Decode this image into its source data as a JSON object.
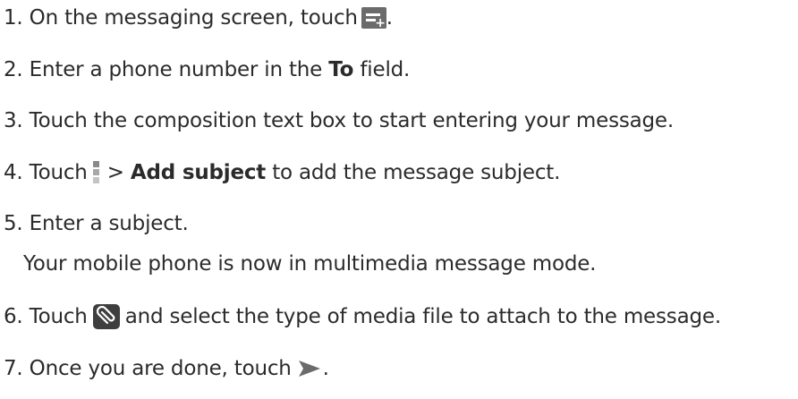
{
  "steps": [
    {
      "number": "1.",
      "text_before": "On the messaging screen, touch",
      "text_after": "."
    },
    {
      "number": "2.",
      "text_before": "Enter a phone number in the",
      "bold": "To",
      "text_after": "field."
    },
    {
      "number": "3.",
      "text": "Touch the composition text box to start entering your message."
    },
    {
      "number": "4.",
      "text_before": "Touch",
      "separator": ">",
      "bold": "Add subject",
      "text_after": "to add the message subject."
    },
    {
      "number": "5.",
      "text": "Enter a subject.",
      "note": "Your mobile phone is now in multimedia message mode."
    },
    {
      "number": "6.",
      "text_before": "Touch",
      "text_after": "and select the type of media file to attach to the message."
    },
    {
      "number": "7.",
      "text_before": "Once you are done, touch",
      "text_after": "."
    }
  ],
  "icons": {
    "new_message": "new-message-icon",
    "menu": "menu-icon",
    "attach": "paperclip-icon",
    "send": "send-icon"
  },
  "colors": {
    "text": "#2b2b2b",
    "icon_gray": "#6b6b6b",
    "icon_dark": "#3e3e3e"
  }
}
